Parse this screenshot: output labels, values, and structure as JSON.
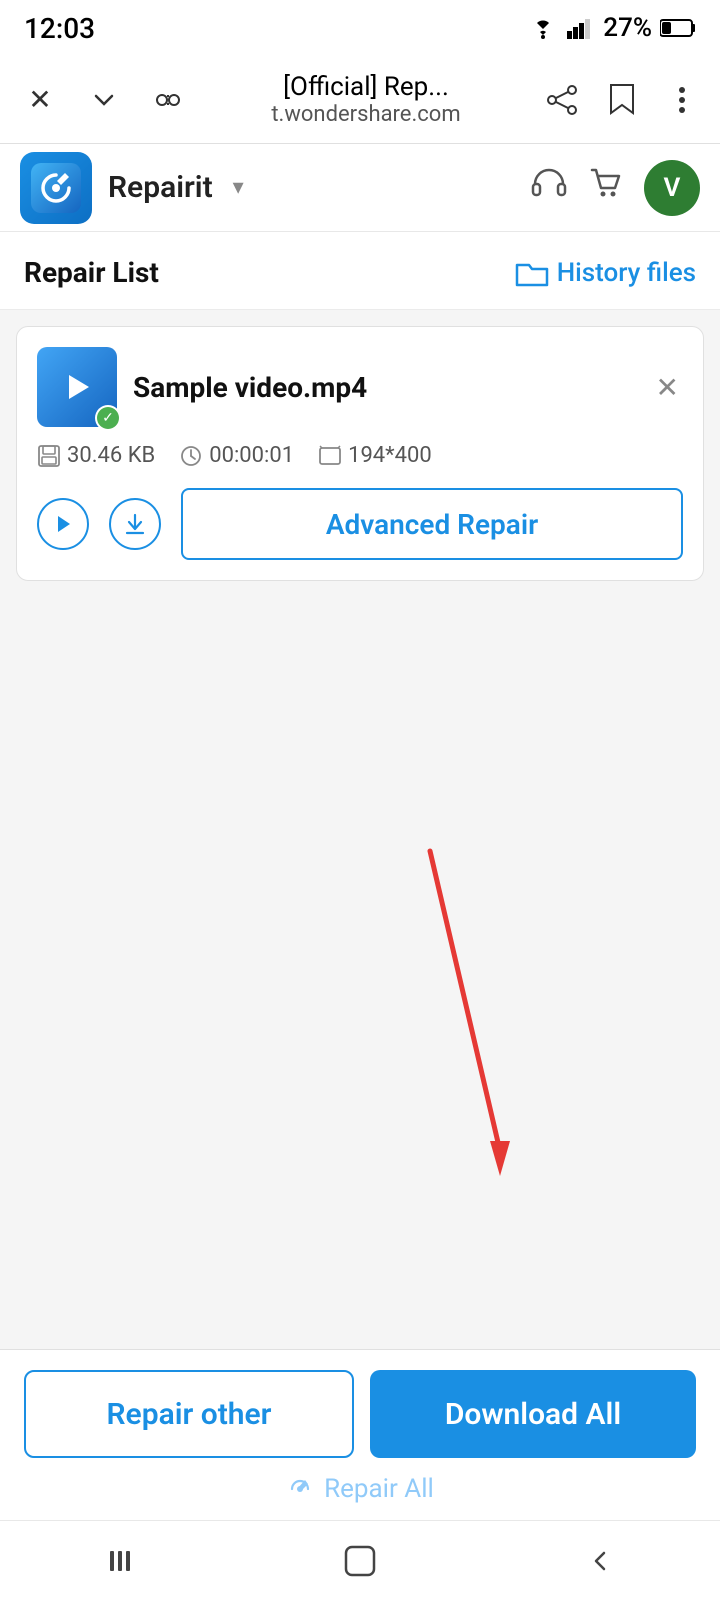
{
  "statusBar": {
    "time": "12:03",
    "battery": "27%",
    "wifiIcon": "wifi",
    "batteryIcon": "battery"
  },
  "browserBar": {
    "title": "[Official] Rep...",
    "domain": "t.wondershare.com"
  },
  "appHeader": {
    "appName": "Repairit",
    "avatarLetter": "V",
    "headsetIcon": "headset",
    "cartIcon": "cart"
  },
  "repairList": {
    "title": "Repair List",
    "historyFiles": "History files"
  },
  "fileCard": {
    "fileName": "Sample video.mp4",
    "fileSize": "30.46 KB",
    "duration": "00:00:01",
    "resolution": "194*400",
    "advancedRepairLabel": "Advanced Repair"
  },
  "bottomBar": {
    "repairOtherLabel": "Repair other",
    "downloadAllLabel": "Download All",
    "repairAllLabel": "Repair All"
  },
  "systemNav": {
    "menuIcon": "|||",
    "homeIcon": "○",
    "backIcon": "<"
  }
}
